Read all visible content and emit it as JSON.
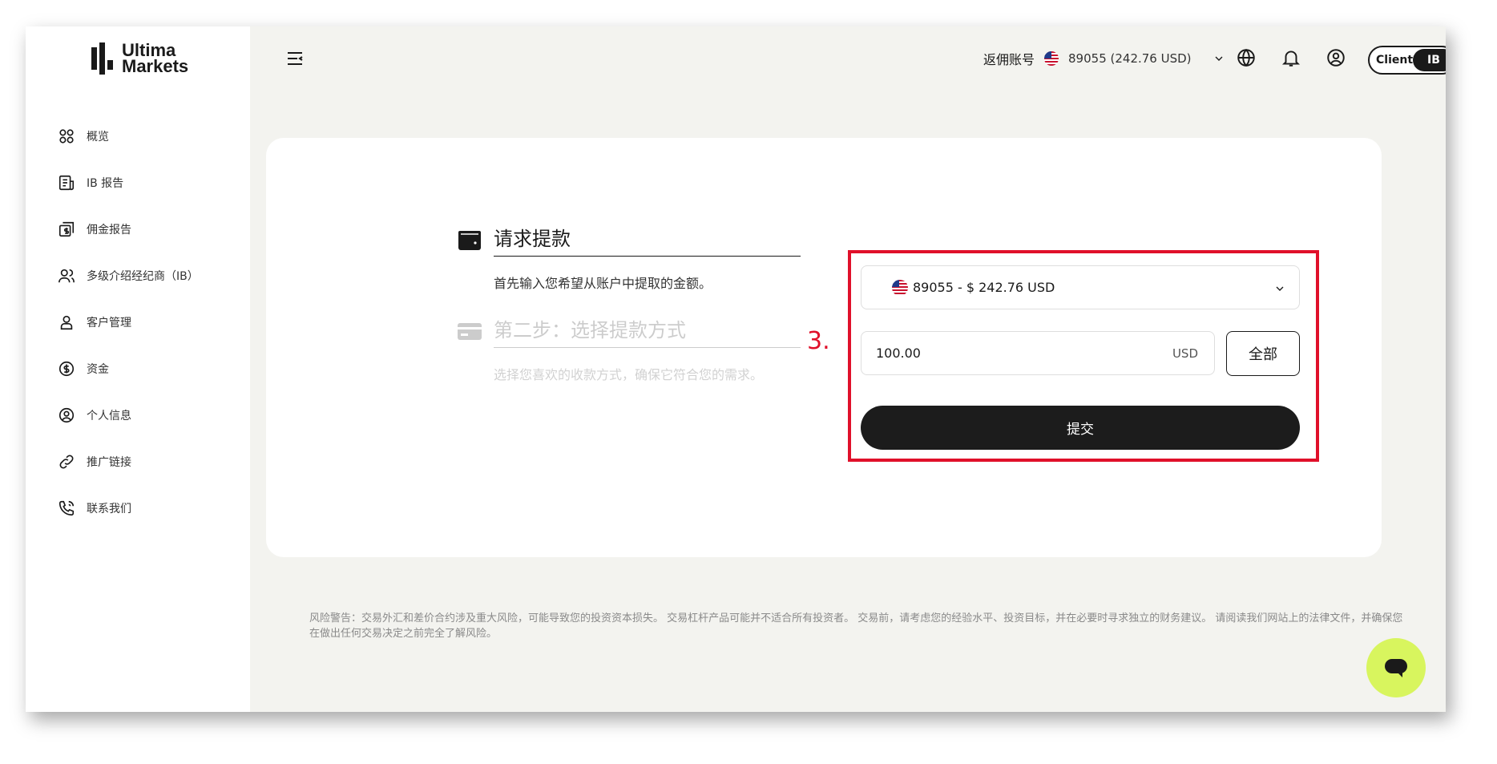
{
  "brand": {
    "line1": "Ultima",
    "line2": "Markets"
  },
  "sidebar": {
    "items": [
      {
        "label": "概览"
      },
      {
        "label": "IB 报告"
      },
      {
        "label": "佣金报告"
      },
      {
        "label": "多级介绍经纪商（IB）"
      },
      {
        "label": "客户管理"
      },
      {
        "label": "资金"
      },
      {
        "label": "个人信息"
      },
      {
        "label": "推广链接"
      },
      {
        "label": "联系我们"
      }
    ]
  },
  "header": {
    "account_label": "返佣账号",
    "account_value": "89055 (242.76 USD)",
    "toggle": {
      "client": "Client",
      "ib": "IB"
    }
  },
  "steps": [
    {
      "title": "请求提款",
      "desc": "首先输入您希望从账户中提取的金额。"
    },
    {
      "title": "第二步：选择提款方式",
      "desc": "选择您喜欢的收款方式，确保它符合您的需求。"
    }
  ],
  "annotation": {
    "marker": "3."
  },
  "form": {
    "account_select": "89055 - $ 242.76 USD",
    "amount_value": "100.00",
    "amount_unit": "USD",
    "all_label": "全部",
    "submit_label": "提交"
  },
  "disclaimer": "风险警告：交易外汇和差价合约涉及重大风险，可能导致您的投资资本损失。 交易杠杆产品可能并不适合所有投资者。 交易前，请考虑您的经验水平、投资目标，并在必要时寻求独立的财务建议。 请阅读我们网站上的法律文件，并确保您在做出任何交易决定之前完全了解风险。",
  "colors": {
    "accent": "#e0102a",
    "chat": "#d8f55e",
    "dark": "#1c1c1c",
    "bg": "#f3f3ef"
  }
}
